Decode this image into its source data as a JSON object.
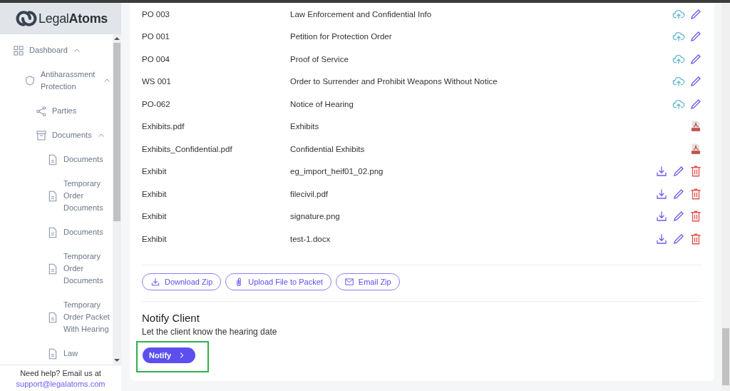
{
  "brand": {
    "light": "Legal",
    "bold": "Atoms"
  },
  "sidebar": {
    "items": [
      {
        "label": "Dashboard",
        "expanded": true,
        "children": [
          {
            "label": "Antiharassment Protection",
            "expanded": true,
            "children": [
              {
                "label": "Parties"
              },
              {
                "label": "Documents",
                "expanded": true,
                "children": [
                  {
                    "label": "Documents"
                  },
                  {
                    "label": "Temporary Order Documents"
                  },
                  {
                    "label": "Documents"
                  },
                  {
                    "label": "Temporary Order Documents"
                  },
                  {
                    "label": "Temporary Order Packet With Hearing"
                  },
                  {
                    "label": "Law"
                  }
                ]
              }
            ]
          }
        ]
      }
    ],
    "help": {
      "text": "Need help? Email us at",
      "email": "support@legalatoms.com"
    }
  },
  "table": {
    "rows": [
      {
        "code": "PO 003",
        "title": "Law Enforcement and Confidential Info",
        "kind": "form"
      },
      {
        "code": "PO 001",
        "title": "Petition for Protection Order",
        "kind": "form"
      },
      {
        "code": "PO 004",
        "title": "Proof of Service",
        "kind": "form"
      },
      {
        "code": "WS 001",
        "title": "Order to Surrender and Prohibit Weapons Without Notice",
        "kind": "form"
      },
      {
        "code": "PO-062",
        "title": "Notice of Hearing",
        "kind": "form"
      },
      {
        "code": "Exhibits.pdf",
        "title": "Exhibits",
        "kind": "pdf"
      },
      {
        "code": "Exhibits_Confidential.pdf",
        "title": "Confidential Exhibits",
        "kind": "pdf"
      },
      {
        "code": "Exhibit",
        "title": "eg_import_heif01_02.png",
        "kind": "upload"
      },
      {
        "code": "Exhibit",
        "title": "filecivil.pdf",
        "kind": "upload"
      },
      {
        "code": "Exhibit",
        "title": "signature.png",
        "kind": "upload"
      },
      {
        "code": "Exhibit",
        "title": "test-1.docx",
        "kind": "upload"
      }
    ]
  },
  "packet_buttons": [
    {
      "label": "Download Zip"
    },
    {
      "label": "Upload File to Packet"
    },
    {
      "label": "Email Zip"
    }
  ],
  "notify": {
    "title": "Notify Client",
    "text": "Let the client know the hearing date",
    "button": "Notify",
    "highlighted": true
  }
}
